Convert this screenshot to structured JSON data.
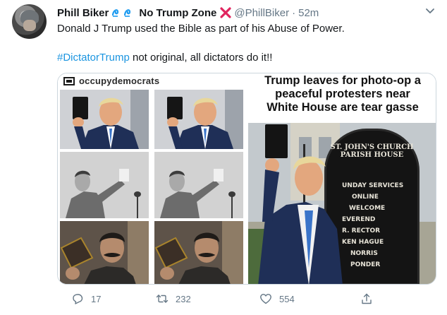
{
  "tweet": {
    "display_name": "Phill Biker",
    "name_suffix": "No Trump Zone",
    "handle": "@PhillBiker",
    "separator": "·",
    "time": "52m",
    "text_line1": "Donald J Trump used the Bible as part of his Abuse of Power.",
    "hashtag": "#DictatorTrump",
    "text_line2_rest": " not original, all dictators do it!!"
  },
  "media": {
    "left_brand": "occupydemocrats",
    "right_headline": [
      "Trump leaves for photo-op a",
      "peaceful protesters near",
      "White House are tear gasse"
    ],
    "sign_title": [
      "ST. JOHN'S CHURCH",
      "PARISH HOUSE"
    ],
    "sign_lines": [
      "UNDAY SERVICES",
      "ONLINE",
      "WELCOME",
      "EVEREND",
      "R. RECTOR",
      "KEN HAGUE",
      "NORRIS",
      "PONDER"
    ]
  },
  "actions": {
    "reply_count": "17",
    "retweet_count": "232",
    "like_count": "554"
  },
  "colors": {
    "link_blue": "#1b95e0",
    "secondary_text": "#657786",
    "x_red": "#e0245e",
    "wave_blue": "#1d9bf0",
    "trump_suit": "#1f2f57"
  },
  "icons": [
    "wave-icon",
    "cross-mark-icon",
    "caret-down-icon",
    "reply-icon",
    "retweet-icon",
    "like-icon",
    "share-icon"
  ]
}
